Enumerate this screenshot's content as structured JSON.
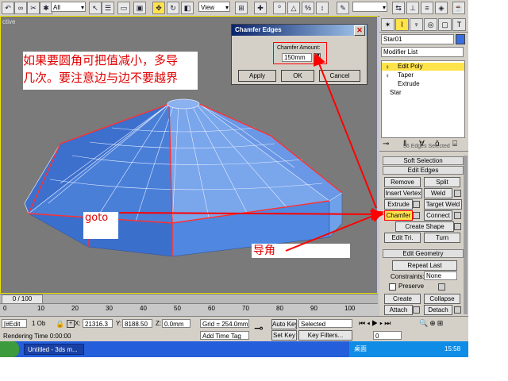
{
  "toolbar": {
    "filter_select": "All",
    "view_select": "View"
  },
  "viewport": {
    "label": "ctive"
  },
  "dialog": {
    "title": "Chamfer Edges",
    "amount_label": "Chamfer Amount:",
    "amount_value": "150mm",
    "apply": "Apply",
    "ok": "OK",
    "cancel": "Cancel"
  },
  "command_panel": {
    "object_name": "Star01",
    "modifier_list": "Modifier List",
    "stack": [
      "Edit Poly",
      "Taper",
      "Extrude",
      "Star"
    ],
    "selection_count": "56 Edges Selected",
    "soft_selection": "Soft Selection",
    "edit_edges": "Edit Edges",
    "remove": "Remove",
    "split": "Split",
    "insert_vertex": "Insert Vertex",
    "weld": "Weld",
    "extrude": "Extrude",
    "target_weld": "Target Weld",
    "chamfer": "Chamfer",
    "connect": "Connect",
    "create_shape": "Create Shape",
    "edit_tri": "Edit Tri.",
    "turn": "Turn",
    "edit_geometry": "Edit Geometry",
    "repeat_last": "Repeat Last",
    "constraints_label": "Constraints:",
    "constraints_value": "None",
    "preserve": "Preserve",
    "create": "Create",
    "collapse": "Collapse",
    "attach": "Attach",
    "detach": "Detach"
  },
  "timeline": {
    "frame": "0 / 100",
    "ticks": [
      "0",
      "10",
      "20",
      "30",
      "40",
      "50",
      "60",
      "70",
      "80",
      "90",
      "100"
    ]
  },
  "status": {
    "mode": "[#Edit_",
    "selection": "1 Ob",
    "x_value": "21316.3",
    "y_value": "8188.50",
    "z_value": "0.0mm",
    "grid": "Grid = 254.0mm",
    "auto_key": "Auto Key",
    "set_key": "Set Key",
    "selected_select": "Selected",
    "key_filters": "Key Filters...",
    "frame_field": "0",
    "rendering_time": "Rendering Time  0:00:00",
    "add_time_tag": "Add Time Tag"
  },
  "taskbar": {
    "task_label": "Untitled - 3ds m...",
    "desktop": "桌面",
    "clock": "15:58"
  },
  "annotations": {
    "main_note_line1": "如果要圆角可把值减小，多导",
    "main_note_line2": "几次。要注意边与边不要越界",
    "goto_note": "goto",
    "chamfer_note": "导角"
  },
  "colors": {
    "highlight": "#ffe34a",
    "annotation_red": "#e00000",
    "mesh_blue": "#4a7fd8"
  }
}
